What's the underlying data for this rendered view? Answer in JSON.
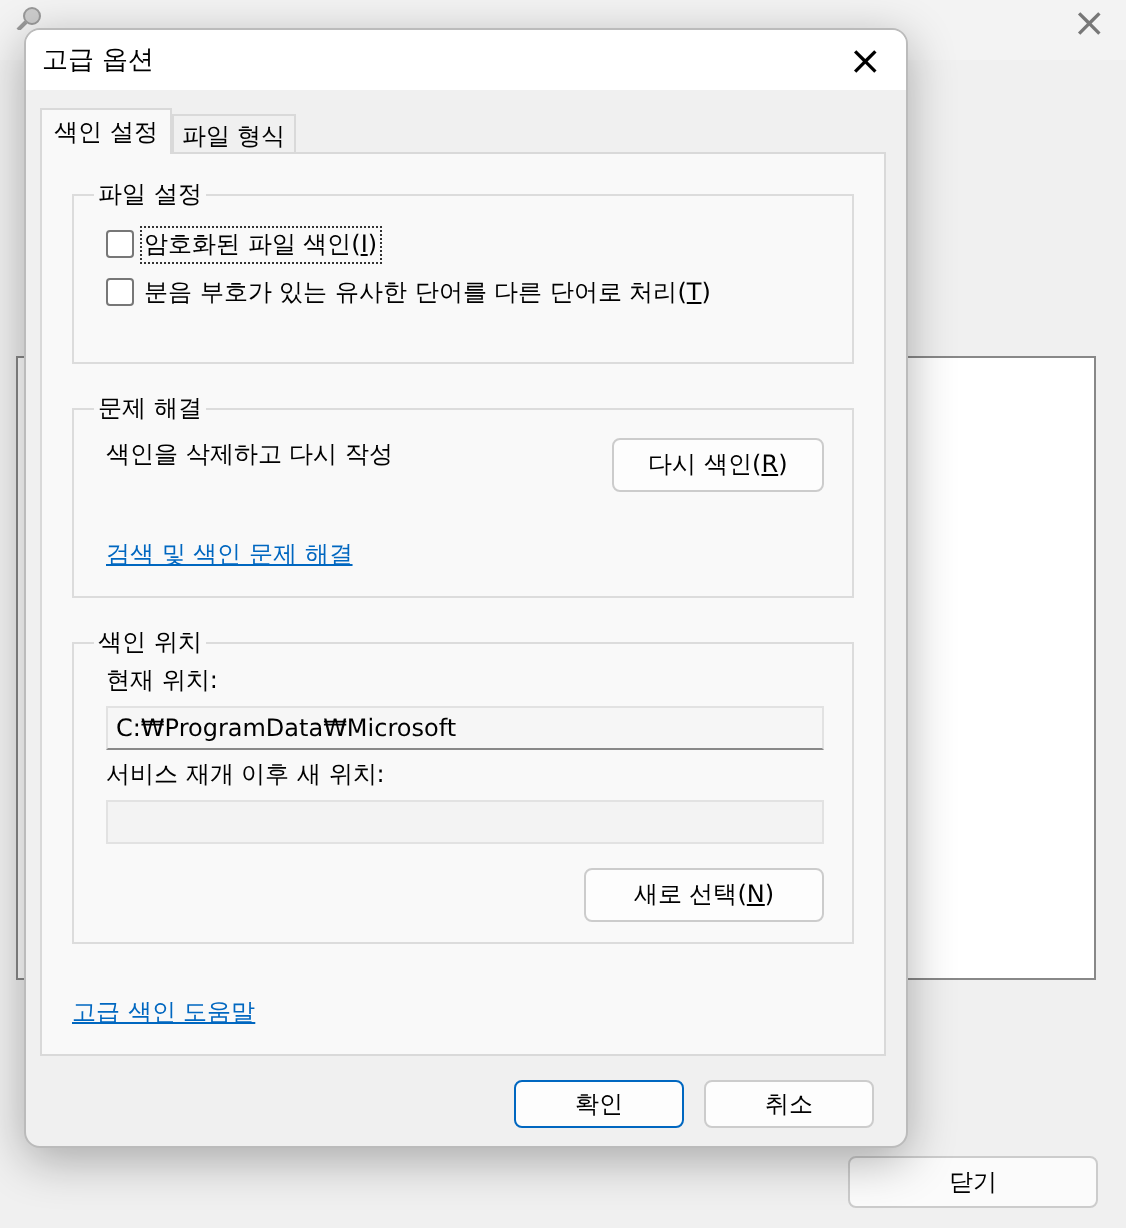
{
  "background_window": {
    "close_button": "×",
    "buttons": [
      "닫기"
    ]
  },
  "dialog": {
    "title": "고급 옵션",
    "close_button": "×",
    "tabs": [
      {
        "label": "색인 설정",
        "selected": true
      },
      {
        "label": "파일 형식",
        "selected": false
      }
    ],
    "file_settings": {
      "title": "파일 설정",
      "options": [
        {
          "label": "암호화된 파일 색인(I)",
          "checked": false,
          "focused": true
        },
        {
          "label": "분음 부호가 있는 유사한 단어를 다른 단어로 처리(T)",
          "checked": false,
          "focused": false
        }
      ]
    },
    "troubleshooting": {
      "title": "문제 해결",
      "description": "색인을 삭제하고 다시 작성",
      "button": "다시 색인(R)",
      "link": "검색 및 색인 문제 해결"
    },
    "index_location": {
      "title": "색인 위치",
      "current_label": "현재 위치:",
      "current_value": "C:₩ProgramData₩Microsoft",
      "new_label": "서비스 재개 이후 새 위치:",
      "button": "새로 선택(N)"
    },
    "help_link": "고급 색인 도움말",
    "buttons": [
      {
        "label": "확인",
        "default": true
      },
      {
        "label": "취소",
        "default": false
      }
    ]
  }
}
